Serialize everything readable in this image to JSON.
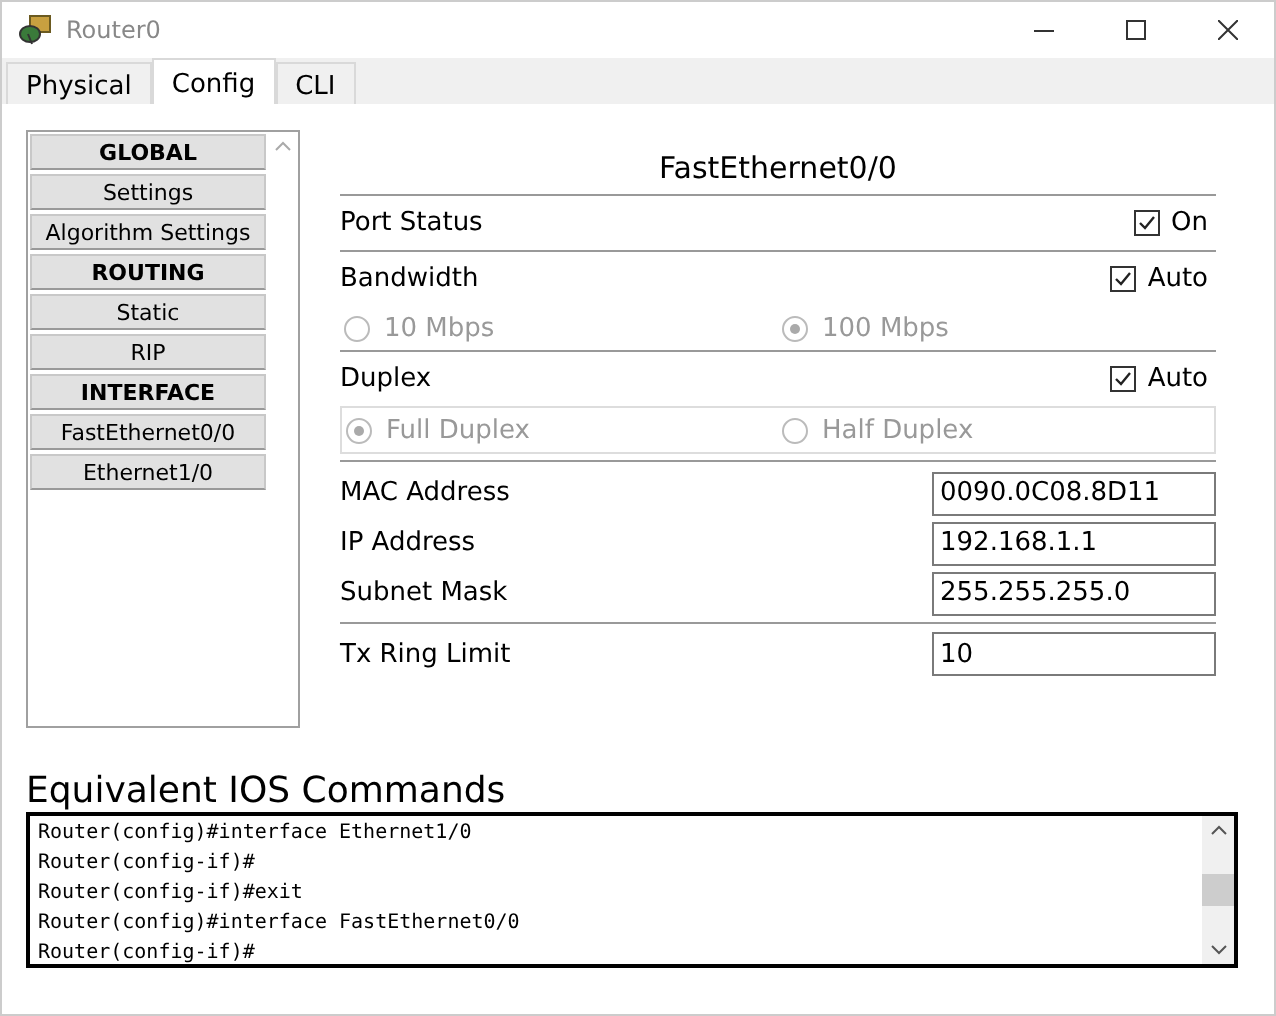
{
  "window": {
    "title": "Router0"
  },
  "tabs": [
    {
      "label": "Physical",
      "selected": false
    },
    {
      "label": "Config",
      "selected": true
    },
    {
      "label": "CLI",
      "selected": false
    }
  ],
  "sidebar": {
    "items": [
      {
        "label": "GLOBAL",
        "kind": "header"
      },
      {
        "label": "Settings",
        "kind": "item"
      },
      {
        "label": "Algorithm Settings",
        "kind": "item"
      },
      {
        "label": "ROUTING",
        "kind": "header"
      },
      {
        "label": "Static",
        "kind": "item"
      },
      {
        "label": "RIP",
        "kind": "item"
      },
      {
        "label": "INTERFACE",
        "kind": "header"
      },
      {
        "label": "FastEthernet0/0",
        "kind": "item"
      },
      {
        "label": "Ethernet1/0",
        "kind": "item"
      }
    ]
  },
  "interface": {
    "title": "FastEthernet0/0",
    "port_status": {
      "label": "Port Status",
      "checkbox_label": "On",
      "checked": true
    },
    "bandwidth": {
      "label": "Bandwidth",
      "checkbox_label": "Auto",
      "checked": true,
      "options": [
        {
          "label": "10 Mbps",
          "selected": false
        },
        {
          "label": "100 Mbps",
          "selected": true
        }
      ]
    },
    "duplex": {
      "label": "Duplex",
      "checkbox_label": "Auto",
      "checked": true,
      "options": [
        {
          "label": "Full Duplex",
          "selected": true
        },
        {
          "label": "Half Duplex",
          "selected": false
        }
      ]
    },
    "address_fields": [
      {
        "label": "MAC Address",
        "value": "0090.0C08.8D11"
      },
      {
        "label": "IP Address",
        "value": "192.168.1.1"
      },
      {
        "label": "Subnet Mask",
        "value": "255.255.255.0"
      }
    ],
    "tx_ring_limit": {
      "label": "Tx Ring Limit",
      "value": "10"
    }
  },
  "ios_commands": {
    "title": "Equivalent IOS Commands",
    "lines": [
      "Router(config)#interface Ethernet1/0",
      "Router(config-if)#",
      "Router(config-if)#exit",
      "Router(config)#interface FastEthernet0/0",
      "Router(config-if)#"
    ]
  }
}
